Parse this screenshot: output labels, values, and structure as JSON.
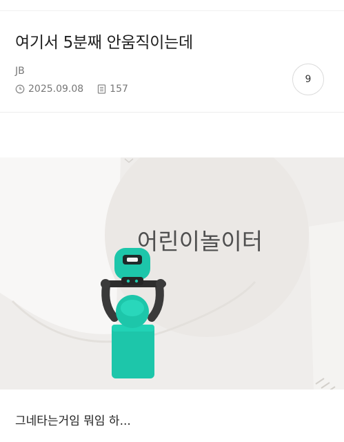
{
  "post": {
    "title": "여기서 5분째 안움직이는데",
    "author": "JB",
    "date": "2025.09.08",
    "views": "157",
    "comment_count": "9"
  },
  "image": {
    "map_label": "어린이놀이터"
  },
  "body": {
    "text": "그네타는거임 뭐임 하..."
  },
  "icons": {
    "date": "clock-icon",
    "views": "document-icon"
  },
  "colors": {
    "robot_teal": "#1dc6aa",
    "map_bg": "#efedeb"
  }
}
